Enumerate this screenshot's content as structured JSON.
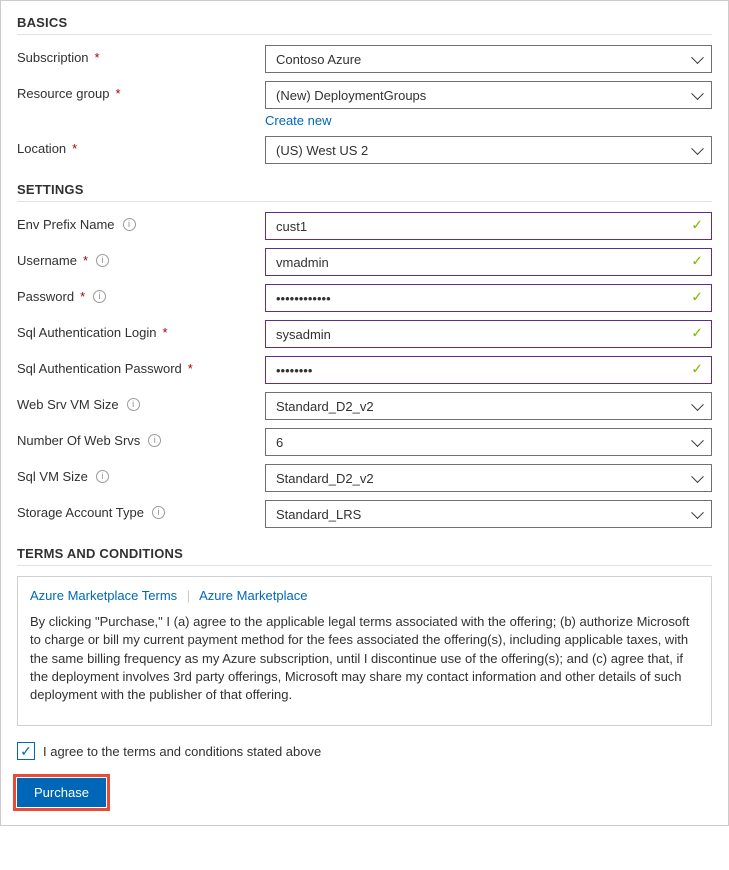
{
  "sections": {
    "basics": "BASICS",
    "settings": "SETTINGS",
    "terms": "TERMS AND CONDITIONS"
  },
  "basics": {
    "subscription_label": "Subscription",
    "subscription_value": "Contoso Azure",
    "resource_group_label": "Resource group",
    "resource_group_value": "(New) DeploymentGroups",
    "create_new": "Create new",
    "location_label": "Location",
    "location_value": "(US) West US 2"
  },
  "settings": {
    "env_prefix_label": "Env Prefix Name",
    "env_prefix_value": "cust1",
    "username_label": "Username",
    "username_value": "vmadmin",
    "password_label": "Password",
    "password_value": "••••••••••••",
    "sql_login_label": "Sql Authentication Login",
    "sql_login_value": "sysadmin",
    "sql_pass_label": "Sql Authentication Password",
    "sql_pass_value": "••••••••",
    "web_vm_size_label": "Web Srv VM Size",
    "web_vm_size_value": "Standard_D2_v2",
    "num_web_srvs_label": "Number Of Web Srvs",
    "num_web_srvs_value": "6",
    "sql_vm_size_label": "Sql VM Size",
    "sql_vm_size_value": "Standard_D2_v2",
    "storage_type_label": "Storage Account Type",
    "storage_type_value": "Standard_LRS"
  },
  "terms": {
    "tab1": "Azure Marketplace Terms",
    "tab2": "Azure Marketplace",
    "body": "By clicking \"Purchase,\" I (a) agree to the applicable legal terms associated with the offering; (b) authorize Microsoft to charge or bill my current payment method for the fees associated the offering(s), including applicable taxes, with the same billing frequency as my Azure subscription, until I discontinue use of the offering(s); and (c) agree that, if the deployment involves 3rd party offerings, Microsoft may share my contact information and other details of such deployment with the publisher of that offering."
  },
  "agree": {
    "label": "I agree to the terms and conditions stated above",
    "checked": true
  },
  "actions": {
    "purchase": "Purchase"
  }
}
